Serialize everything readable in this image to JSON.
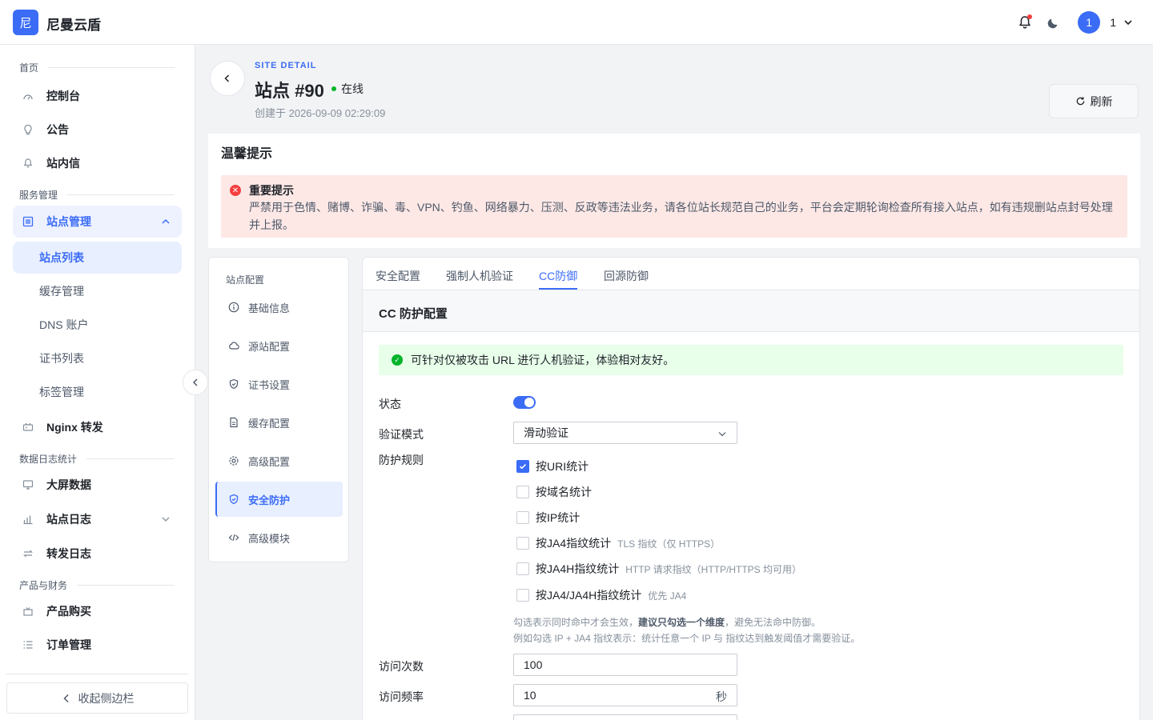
{
  "app": {
    "logo_char": "尼",
    "brand": "尼曼云盾"
  },
  "topbar": {
    "avatar_initial": "1",
    "user_name": "1"
  },
  "sidebar": {
    "sections": {
      "home": "首页",
      "service": "服务管理",
      "data": "数据日志统计",
      "product": "产品与财务"
    },
    "items": {
      "console": "控制台",
      "announce": "公告",
      "inbox": "站内信",
      "site_mgmt": "站点管理",
      "site_list": "站点列表",
      "cache_mgmt": "缓存管理",
      "dns": "DNS 账户",
      "certs": "证书列表",
      "tags": "标签管理",
      "nginx": "Nginx 转发",
      "screen": "大屏数据",
      "site_log": "站点日志",
      "forward_log": "转发日志",
      "buy": "产品购买",
      "orders": "订单管理"
    },
    "collapse_label": "收起侧边栏"
  },
  "header": {
    "eyebrow": "SITE DETAIL",
    "title": "站点 #90",
    "status": "在线",
    "created": "创建于 2026-09-09 02:29:09",
    "refresh": "刷新"
  },
  "notice": {
    "heading": "温馨提示",
    "title": "重要提示",
    "text": "严禁用于色情、赌博、诈骗、毒、VPN、钓鱼、网络暴力、压测、反政等违法业务，请各位站长规范自己的业务，平台会定期轮询检查所有接入站点，如有违规删站点封号处理并上报。"
  },
  "config_nav": {
    "title": "站点配置",
    "items": [
      "基础信息",
      "源站配置",
      "证书设置",
      "缓存配置",
      "高级配置",
      "安全防护",
      "高级模块"
    ]
  },
  "tabs": [
    "安全配置",
    "强制人机验证",
    "CC防御",
    "回源防御"
  ],
  "cc": {
    "title": "CC 防护配置",
    "info": "可针对仅被攻击 URL 进行人机验证，体验相对友好。",
    "status_label": "状态",
    "mode_label": "验证模式",
    "mode_value": "滑动验证",
    "rules_label": "防护规则",
    "rules": [
      {
        "label": "按URI统计",
        "hint": "",
        "checked": true
      },
      {
        "label": "按域名统计",
        "hint": "",
        "checked": false
      },
      {
        "label": "按IP统计",
        "hint": "",
        "checked": false
      },
      {
        "label": "按JA4指纹统计",
        "hint": "TLS 指纹（仅 HTTPS）",
        "checked": false
      },
      {
        "label": "按JA4H指纹统计",
        "hint": "HTTP 请求指纹（HTTP/HTTPS 均可用）",
        "checked": false
      },
      {
        "label": "按JA4/JA4H指纹统计",
        "hint": "优先 JA4",
        "checked": false
      }
    ],
    "tip1_pre": "勾选表示同时命中才会生效，",
    "tip1_bold": "建议只勾选一个维度",
    "tip1_post": "，避免无法命中防御。",
    "tip2": "例如勾选 IP + JA4 指纹表示：统计任意一个 IP 与 指纹达到触发阈值才需要验证。",
    "visits_label": "访问次数",
    "visits_value": "100",
    "freq_label": "访问频率",
    "freq_value": "10",
    "freq_unit": "秒"
  }
}
